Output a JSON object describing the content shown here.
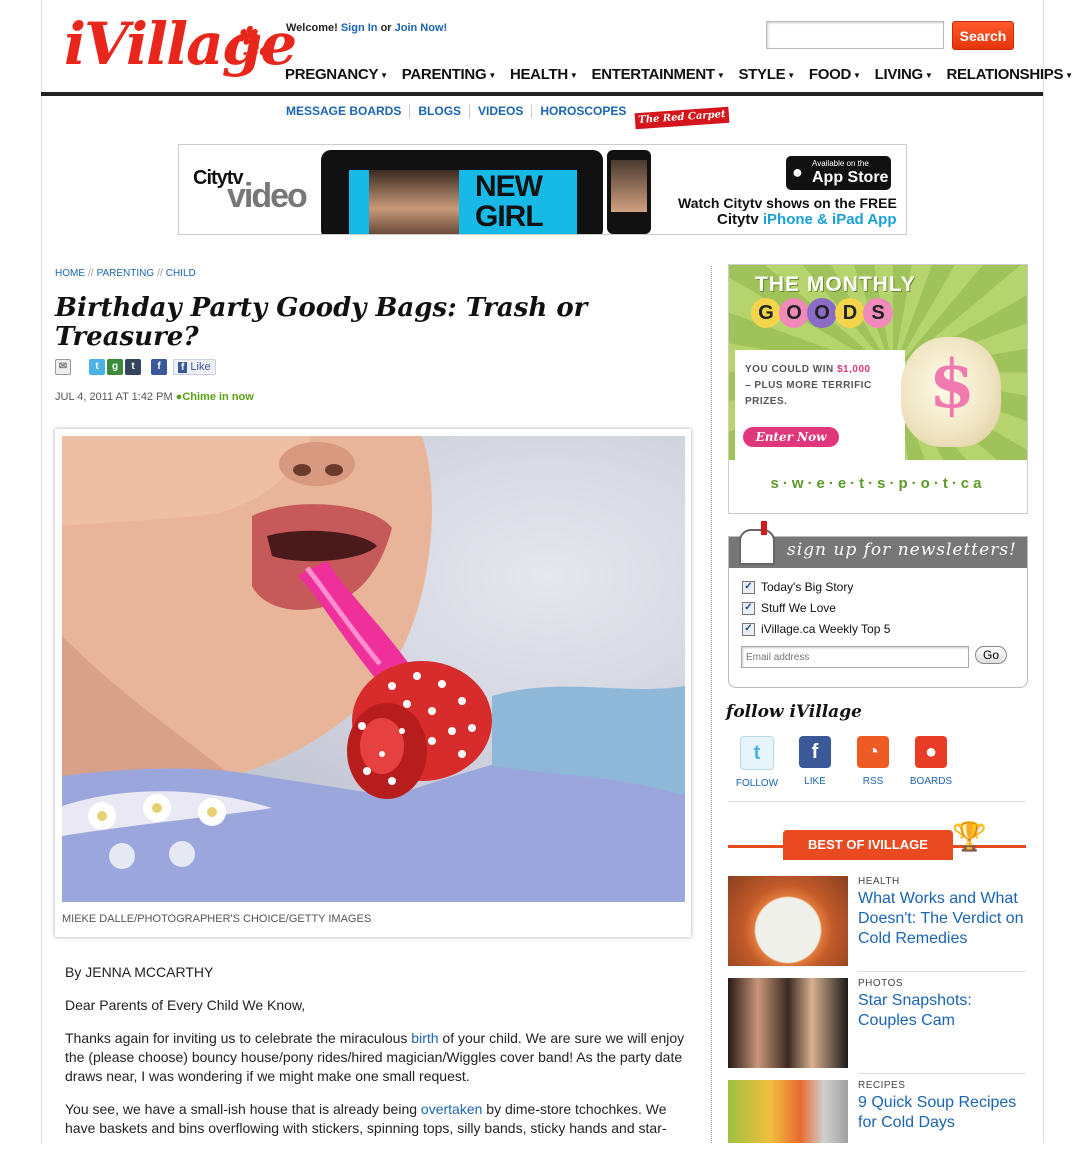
{
  "header": {
    "logo_text": "iVillage",
    "logo_suffix": ".ca",
    "welcome_text": "Welcome!",
    "sign_in": "Sign In",
    "or_text": "or",
    "join_now": "Join Now!",
    "search_placeholder": "",
    "search_button": "Search"
  },
  "main_nav": [
    "PREGNANCY",
    "PARENTING",
    "HEALTH",
    "ENTERTAINMENT",
    "STYLE",
    "FOOD",
    "LIVING",
    "RELATIONSHIPS"
  ],
  "sub_nav": [
    "MESSAGE BOARDS",
    "BLOGS",
    "VIDEOS",
    "HOROSCOPES"
  ],
  "red_carpet": "The Red Carpet",
  "ad_banner": {
    "brand": "Citytv",
    "brand_video": "video",
    "show_line1": "NEW",
    "show_line2": "GIRL",
    "appstore_small": "Available on the",
    "appstore_big": "App Store",
    "watch_line1": "Watch Citytv shows on the FREE",
    "watch_line2_prefix": "Citytv",
    "watch_line2_suffix": "iPhone & iPad App"
  },
  "breadcrumb": [
    "HOME",
    "PARENTING",
    "CHILD"
  ],
  "breadcrumb_sep": "//",
  "article": {
    "title": "Birthday Party Goody Bags: Trash or Treasure?",
    "like_label": "Like",
    "date": "JUL 4, 2011 AT 1:42 PM",
    "chime": "Chime in now",
    "photo_caption": "MIEKE DALLE/PHOTOGRAPHER'S CHOICE/GETTY IMAGES",
    "byline": "By JENNA MCCARTHY",
    "salutation": "Dear Parents of Every Child We Know,",
    "p1_before": "Thanks again for inviting us to celebrate the miraculous ",
    "p1_link": "birth",
    "p1_after": " of your child. We are sure we will enjoy the (please choose) bouncy house/pony rides/hired magician/Wiggles cover band! As the party date draws near, I was wondering if we might make one small request.",
    "p2_before": "You see, we have a small-ish house that is already being ",
    "p2_link": "overtaken",
    "p2_after": " by dime-store tchochkes. We have baskets and bins overflowing with stickers, spinning tops, silly bands, sticky hands and star-"
  },
  "promo": {
    "monthly": "THE MONTHLY",
    "goods_letters": [
      "G",
      "O",
      "O",
      "D",
      "S"
    ],
    "win_prefix": "YOU COULD WIN ",
    "win_amount": "$1,000",
    "win_rest": "– PLUS MORE TERRIFIC PRIZES.",
    "enter": "Enter Now",
    "sweetspot": "s·w·e·e·t·s·p·o·t·ca",
    "dollar": "$"
  },
  "newsletter": {
    "heading": "sign up for newsletters!",
    "items": [
      "Today's Big Story",
      "Stuff We Love",
      "iVillage.ca Weekly Top 5"
    ],
    "email_placeholder": "Email address",
    "go": "Go"
  },
  "follow": {
    "title": "follow iVillage",
    "items": [
      {
        "label": "FOLLOW",
        "icon": "twitter-icon",
        "color": "#4ab3e6"
      },
      {
        "label": "LIKE",
        "icon": "facebook-icon",
        "color": "#3b5998"
      },
      {
        "label": "RSS",
        "icon": "rss-icon",
        "color": "#ee5a24"
      },
      {
        "label": "BOARDS",
        "icon": "boards-icon",
        "color": "#e83c26"
      }
    ]
  },
  "best_of": {
    "label": "BEST OF IVILLAGE",
    "stories": [
      {
        "category": "HEALTH",
        "headline": "What Works and What Doesn't: The Verdict on Cold Remedies"
      },
      {
        "category": "PHOTOS",
        "headline": "Star Snapshots: Couples Cam"
      },
      {
        "category": "RECIPES",
        "headline": "9 Quick Soup Recipes for Cold Days"
      }
    ]
  },
  "colors": {
    "brand_red": "#e8261c",
    "link_blue": "#1a64b0",
    "accent_orange": "#e94a1f",
    "chime_green": "#59a113"
  }
}
